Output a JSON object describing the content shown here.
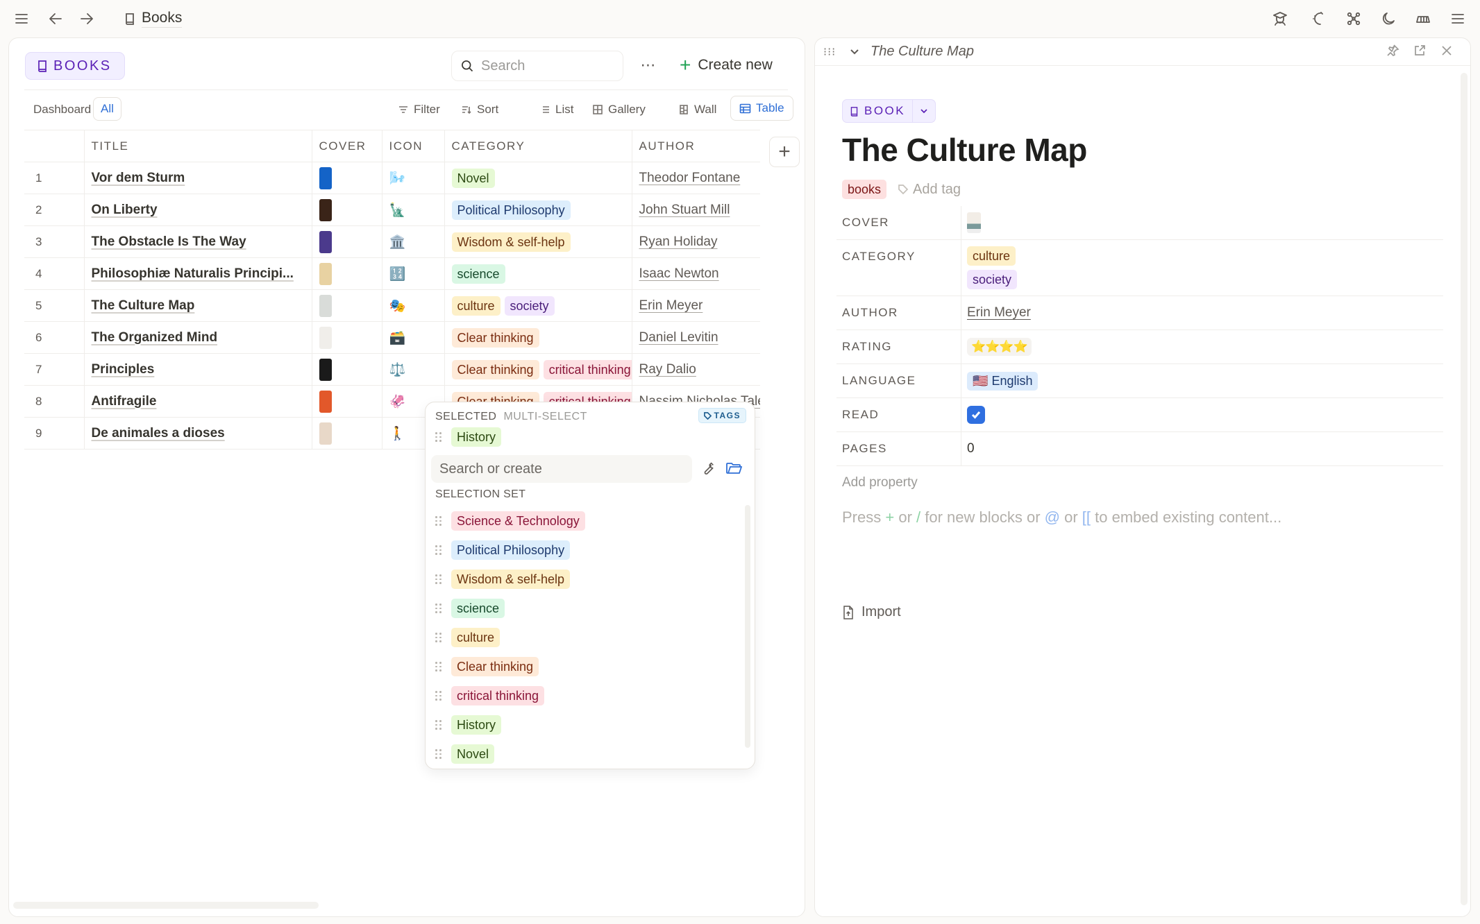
{
  "topbar": {
    "breadcrumb": "Books",
    "icons": [
      "menu-icon",
      "back-arrow-icon",
      "forward-arrow-icon",
      "graduation-cap-icon",
      "sparkle-moon-icon",
      "graph-nodes-icon",
      "moon-icon",
      "library-icon",
      "hamburger-icon"
    ]
  },
  "left": {
    "db_badge": "BOOKS",
    "search_placeholder": "Search",
    "more_label": "⋯",
    "create_label": "Create new",
    "tabs": {
      "dashboard": "Dashboard",
      "all": "All"
    },
    "view_options": {
      "filter": "Filter",
      "sort": "Sort",
      "list": "List",
      "gallery": "Gallery",
      "wall": "Wall",
      "table": "Table"
    },
    "columns": [
      "",
      "TITLE",
      "COVER",
      "ICON",
      "CATEGORY",
      "AUTHOR"
    ],
    "rows": [
      {
        "n": "1",
        "title": "Vor dem Sturm",
        "cover_color": "#1463c7",
        "icon": "🌬️",
        "categories": [
          {
            "label": "Novel",
            "style": "lime"
          }
        ],
        "author": "Theodor Fontane"
      },
      {
        "n": "2",
        "title": "On Liberty",
        "cover_color": "#3a2418",
        "icon": "🗽",
        "categories": [
          {
            "label": "Political Philosophy",
            "style": "blue"
          }
        ],
        "author": "John Stuart Mill"
      },
      {
        "n": "3",
        "title": "The Obstacle Is The Way",
        "cover_color": "#4b3a8c",
        "icon": "🏛️",
        "categories": [
          {
            "label": "Wisdom & self-help",
            "style": "yellow"
          }
        ],
        "author": "Ryan Holiday"
      },
      {
        "n": "4",
        "title": "Philosophiæ Naturalis Principi...",
        "cover_color": "#e8d2a2",
        "icon": "🔢",
        "categories": [
          {
            "label": "science",
            "style": "green"
          }
        ],
        "author": "Isaac Newton"
      },
      {
        "n": "5",
        "title": "The Culture Map",
        "cover_color": "#d9dcd9",
        "icon": "🎭",
        "categories": [
          {
            "label": "culture",
            "style": "yellow"
          },
          {
            "label": "society",
            "style": "purple"
          }
        ],
        "author": "Erin Meyer"
      },
      {
        "n": "6",
        "title": "The Organized Mind",
        "cover_color": "#f0eeea",
        "icon": "🗃️",
        "categories": [
          {
            "label": "Clear thinking",
            "style": "orange"
          }
        ],
        "author": "Daniel Levitin"
      },
      {
        "n": "7",
        "title": "Principles",
        "cover_color": "#1a1a1a",
        "icon": "⚖️",
        "categories": [
          {
            "label": "Clear thinking",
            "style": "orange"
          },
          {
            "label": "critical thinking",
            "style": "red"
          }
        ],
        "author": "Ray Dalio"
      },
      {
        "n": "8",
        "title": "Antifragile",
        "cover_color": "#e2582a",
        "icon": "🦑",
        "categories": [
          {
            "label": "Clear thinking",
            "style": "orange"
          },
          {
            "label": "critical thinking",
            "style": "red"
          }
        ],
        "author": "Nassim Nicholas Taleb"
      },
      {
        "n": "9",
        "title": "De animales a dioses",
        "cover_color": "#e8d8c8",
        "icon": "🚶",
        "categories": [],
        "author": ""
      }
    ]
  },
  "popover": {
    "selected_label": "SELECTED",
    "type_label": "MULTI-SELECT",
    "tags_chip": "TAGS",
    "selected": [
      {
        "label": "History",
        "style": "lime"
      }
    ],
    "search_placeholder": "Search or create",
    "set_title": "SELECTION SET",
    "options": [
      {
        "label": "Science & Technology",
        "style": "red"
      },
      {
        "label": "Political Philosophy",
        "style": "blue"
      },
      {
        "label": "Wisdom & self-help",
        "style": "yellow"
      },
      {
        "label": "science",
        "style": "green"
      },
      {
        "label": "culture",
        "style": "yellow"
      },
      {
        "label": "Clear thinking",
        "style": "orange"
      },
      {
        "label": "critical thinking",
        "style": "red"
      },
      {
        "label": "History",
        "style": "lime"
      },
      {
        "label": "Novel",
        "style": "lime"
      }
    ]
  },
  "right": {
    "header_title": "The Culture Map",
    "type_chip": "BOOK",
    "page_title": "The Culture Map",
    "tags": [
      {
        "label": "books",
        "style": "redtag"
      }
    ],
    "add_tag": "Add tag",
    "properties": {
      "cover": {
        "key": "COVER"
      },
      "category": {
        "key": "CATEGORY",
        "values": [
          {
            "label": "culture",
            "style": "yellow"
          },
          {
            "label": "society",
            "style": "purple"
          }
        ]
      },
      "author": {
        "key": "AUTHOR",
        "value": "Erin Meyer"
      },
      "rating": {
        "key": "RATING",
        "value": "⭐⭐⭐⭐",
        "stars": 4
      },
      "language": {
        "key": "LANGUAGE",
        "flag": "🇺🇸",
        "value": "English"
      },
      "read": {
        "key": "READ",
        "checked": true
      },
      "pages": {
        "key": "PAGES",
        "value": "0"
      }
    },
    "add_property": "Add property",
    "placeholder": {
      "p1": "Press ",
      "plus": "+",
      "p2": " or ",
      "slash": "/",
      "p3": " for new blocks or ",
      "at": "@",
      "p4": " or ",
      "brackets": "[[",
      "p5": " to embed existing content..."
    },
    "import_label": "Import"
  },
  "tag_styles": {
    "lime": {
      "bg": "#e6f9d4",
      "fg": "#2c4a12"
    },
    "blue": {
      "bg": "#ddeefc",
      "fg": "#1e3a6e"
    },
    "yellow": {
      "bg": "#fdf0c8",
      "fg": "#6b3410"
    },
    "green": {
      "bg": "#d9f7e4",
      "fg": "#174a2c"
    },
    "purple": {
      "bg": "#f1e6fd",
      "fg": "#4a1e7a"
    },
    "orange": {
      "bg": "#feead8",
      "fg": "#7a2c10"
    },
    "red": {
      "bg": "#fde0e3",
      "fg": "#8a1538"
    },
    "redtag": {
      "bg": "#fde0e0",
      "fg": "#7a1515"
    }
  }
}
